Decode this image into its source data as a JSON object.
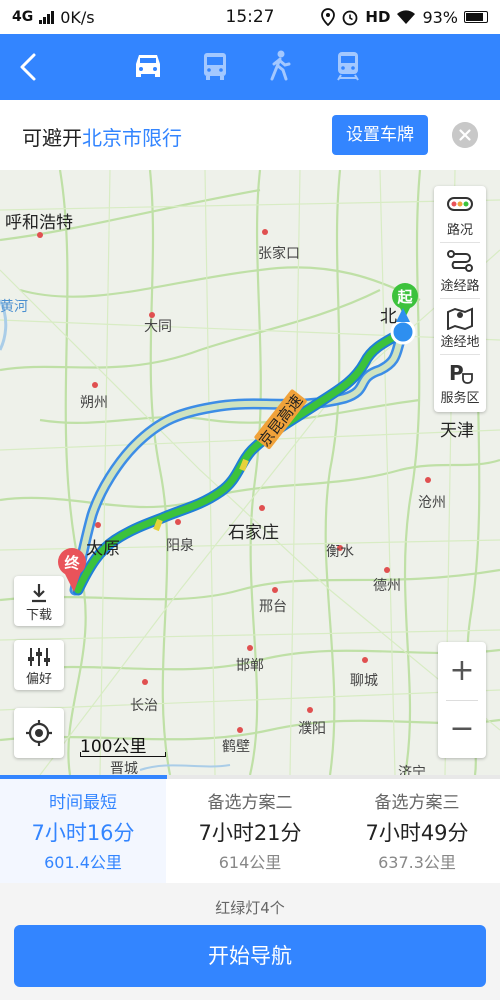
{
  "status_bar": {
    "network": "4G",
    "speed": "0K/s",
    "time": "15:27",
    "hd": "HD",
    "battery": "93%",
    "icons": [
      "signal-icon",
      "location-icon",
      "alarm-icon",
      "wifi-icon",
      "battery-icon"
    ]
  },
  "nav": {
    "back_icon": "back-arrow-icon",
    "modes": [
      {
        "icon": "car-icon",
        "active": true
      },
      {
        "icon": "bus-icon",
        "active": false
      },
      {
        "icon": "walk-icon",
        "active": false
      },
      {
        "icon": "train-icon",
        "active": false
      }
    ]
  },
  "restriction": {
    "prefix": "可避开",
    "city": "北京市限行",
    "plate_button": "设置车牌",
    "close_icon": "close-icon"
  },
  "map": {
    "cities": [
      "呼和浩特",
      "张家口",
      "大同",
      "朔州",
      "北",
      "天津",
      "沧州",
      "太原",
      "阳泉",
      "石家庄",
      "衡水",
      "德州",
      "邢台",
      "聊城",
      "邯郸",
      "长治",
      "濮阳",
      "鹤壁",
      "晋城",
      "黄河",
      "济宁"
    ],
    "highway_label": "京昆高速",
    "start_marker": "起",
    "end_marker": "终",
    "right_tools": [
      {
        "label": "路况",
        "icon": "traffic-icon"
      },
      {
        "label": "途经路",
        "icon": "route-via-icon"
      },
      {
        "label": "途经地",
        "icon": "map-pin-icon"
      },
      {
        "label": "服务区",
        "icon": "parking-cafe-icon"
      }
    ],
    "download_label": "下载",
    "preference_label": "偏好",
    "zoom_in": "+",
    "zoom_out": "−",
    "scale": "100公里",
    "colors": {
      "route_green": "#3cc23c",
      "route_blue": "#3d8de6",
      "accent": "#3385ff"
    }
  },
  "routes": [
    {
      "name": "时间最短",
      "time": "7小时16分",
      "distance": "601.4公里",
      "selected": true
    },
    {
      "name": "备选方案二",
      "time": "7小时21分",
      "distance": "614公里",
      "selected": false
    },
    {
      "name": "备选方案三",
      "time": "7小时49分",
      "distance": "637.3公里",
      "selected": false
    }
  ],
  "route_progress": 0.333,
  "traffic_lights": "红绿灯4个",
  "start_button": "开始导航"
}
